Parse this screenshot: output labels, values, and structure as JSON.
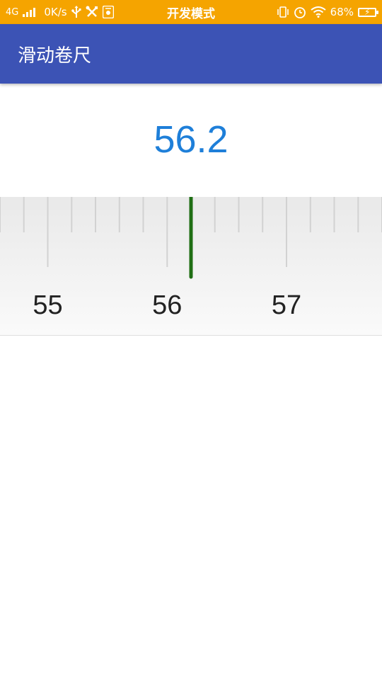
{
  "colors": {
    "status_bar": "#f5a400",
    "app_bar": "#3c53b5",
    "value_text": "#1e7fd9",
    "indicator": "#1f6e14"
  },
  "status_bar": {
    "network": "4G",
    "speed": "0K/s",
    "center_text": "开发模式",
    "battery_percent": "68%",
    "icons": [
      "signal-icon",
      "usb-icon",
      "tools-icon",
      "debug-icon",
      "vibrate-icon",
      "alarm-icon",
      "wifi-icon",
      "battery-icon"
    ]
  },
  "app_bar": {
    "title": "滑动卷尺"
  },
  "readout": {
    "value": "56.2"
  },
  "ruler": {
    "current_value": 56.2,
    "min_visible": 54.6,
    "max_visible": 57.8,
    "labels": [
      "55",
      "56",
      "57"
    ]
  }
}
